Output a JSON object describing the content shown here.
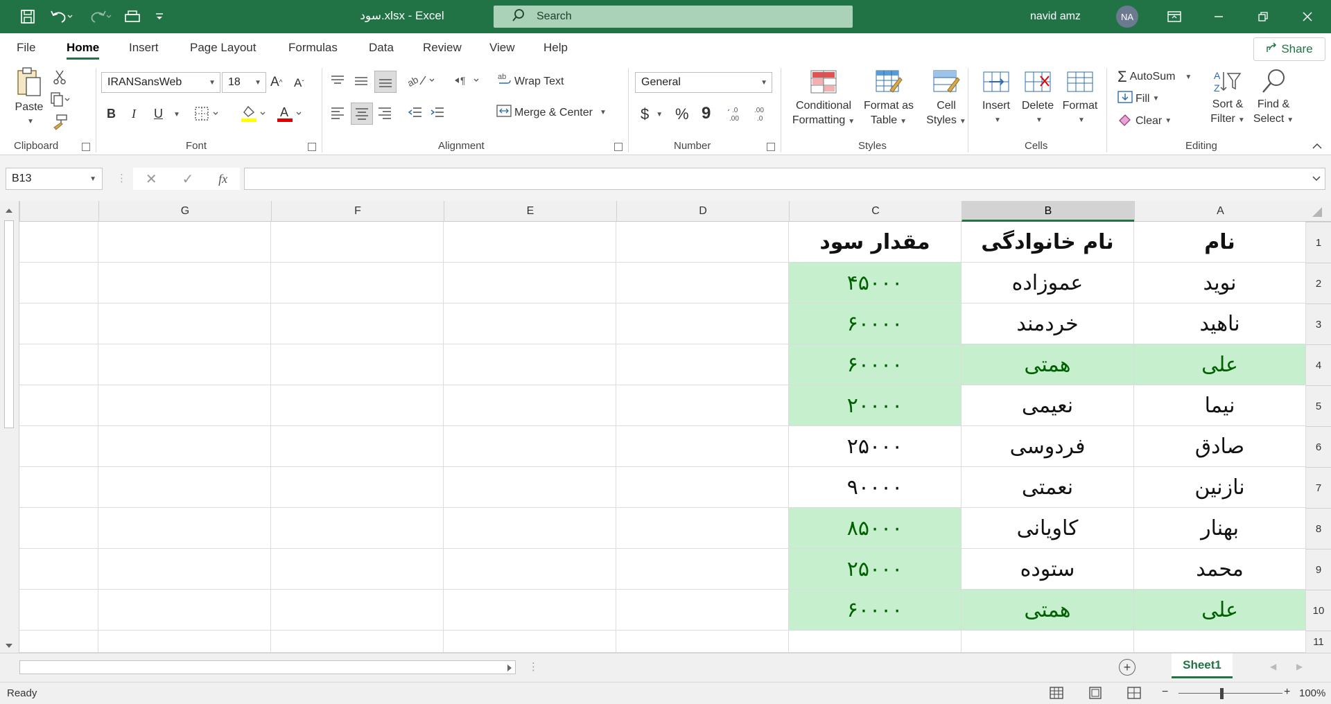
{
  "window": {
    "title": "سود.xlsx  -  Excel",
    "search_placeholder": "Search",
    "user_name": "navid amz",
    "user_initials": "NA"
  },
  "ribbon_tabs": [
    "File",
    "Home",
    "Insert",
    "Page Layout",
    "Formulas",
    "Data",
    "Review",
    "View",
    "Help"
  ],
  "share_label": "Share",
  "ribbon": {
    "clipboard": {
      "label": "Clipboard",
      "paste": "Paste"
    },
    "font": {
      "label": "Font",
      "font_name": "IRANSansWeb",
      "font_size": "18",
      "bold": "B",
      "italic": "I",
      "underline": "U"
    },
    "alignment": {
      "label": "Alignment",
      "wrap_text": "Wrap Text",
      "merge_center": "Merge & Center"
    },
    "number": {
      "label": "Number",
      "format": "General",
      "currency": "$",
      "percent": "%",
      "comma": "9"
    },
    "styles": {
      "label": "Styles",
      "conditional_1": "Conditional",
      "conditional_2": "Formatting",
      "format_table_1": "Format as",
      "format_table_2": "Table",
      "cell_styles_1": "Cell",
      "cell_styles_2": "Styles"
    },
    "cells": {
      "label": "Cells",
      "insert": "Insert",
      "delete": "Delete",
      "format": "Format"
    },
    "editing": {
      "label": "Editing",
      "autosum": "AutoSum",
      "fill": "Fill",
      "clear": "Clear",
      "sort_1": "Sort &",
      "sort_2": "Filter",
      "find_1": "Find &",
      "find_2": "Select"
    }
  },
  "formula_bar": {
    "name_box": "B13",
    "fx": "fx",
    "value": ""
  },
  "columns": [
    "A",
    "B",
    "C",
    "D",
    "E",
    "F",
    "G"
  ],
  "rows": [
    "1",
    "2",
    "3",
    "4",
    "5",
    "6",
    "7",
    "8",
    "9",
    "10",
    "11"
  ],
  "table": {
    "headers": [
      "نام",
      "نام خانوادگی",
      "مقدار سود"
    ],
    "data": [
      [
        "نوید",
        "عموزاده",
        "۴۵۰۰۰"
      ],
      [
        "ناهید",
        "خردمند",
        "۶۰۰۰۰"
      ],
      [
        "علی",
        "همتی",
        "۶۰۰۰۰"
      ],
      [
        "نیما",
        "نعیمی",
        "۲۰۰۰۰"
      ],
      [
        "صادق",
        "فردوسی",
        "۲۵۰۰۰"
      ],
      [
        "نازنین",
        "نعمتی",
        "۹۰۰۰۰"
      ],
      [
        "بهنار",
        "کاویانی",
        "۸۵۰۰۰"
      ],
      [
        "محمد",
        "ستوده",
        "۲۵۰۰۰"
      ],
      [
        "علی",
        "همتی",
        "۶۰۰۰۰"
      ]
    ]
  },
  "highlight_color": "#c6efce",
  "highlight_text_color": "#006100",
  "accent_color": "#217346",
  "sheet_tab": "Sheet1",
  "status": {
    "text": "Ready",
    "zoom": "100%"
  }
}
